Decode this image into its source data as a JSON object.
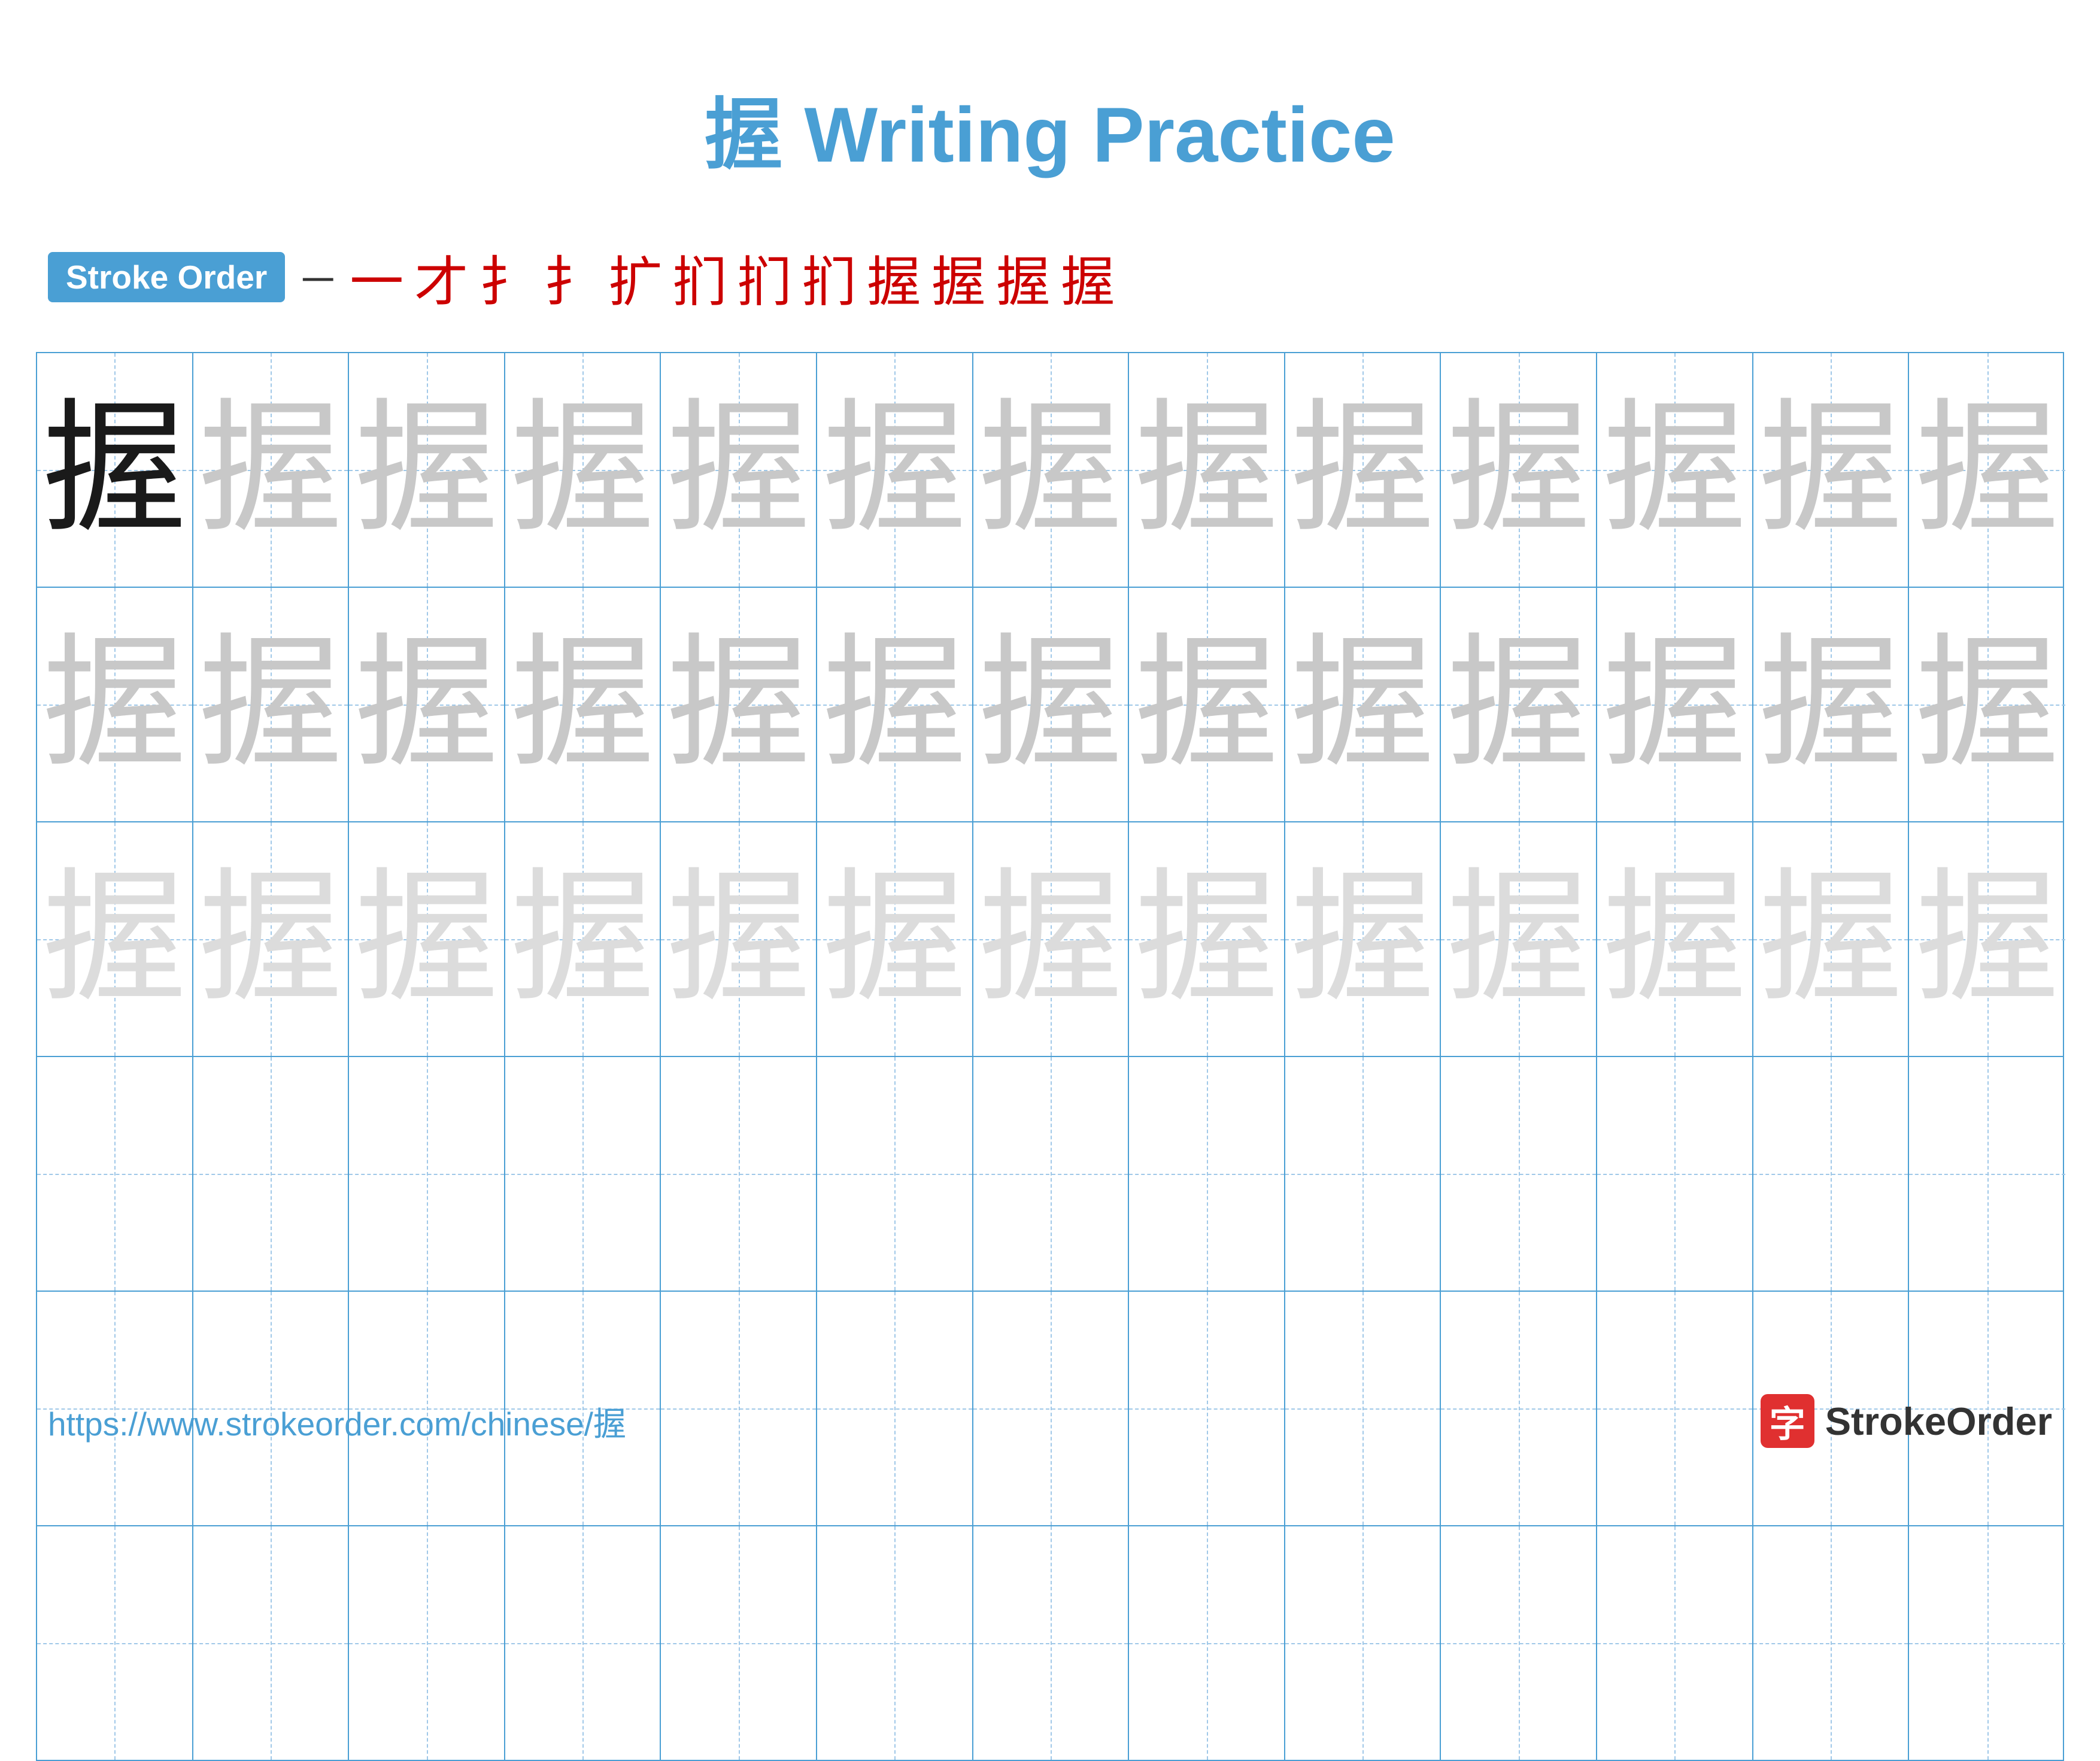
{
  "title": {
    "char": "握",
    "suffix": " Writing Practice",
    "full": "握 Writing Practice"
  },
  "stroke_order": {
    "badge_label": "Stroke Order",
    "separator": "-",
    "strokes": [
      "一",
      "才",
      "扌",
      "扌",
      "扩",
      "扪",
      "扪",
      "扪",
      "握",
      "握",
      "握",
      "握"
    ]
  },
  "grid": {
    "rows": 6,
    "cols": 13,
    "character": "握",
    "row_styles": [
      "dark",
      "medium",
      "light",
      "empty",
      "empty",
      "empty"
    ]
  },
  "footer": {
    "url": "https://www.strokeorder.com/chinese/握",
    "logo_char": "字",
    "logo_text": "StrokeOrder"
  }
}
